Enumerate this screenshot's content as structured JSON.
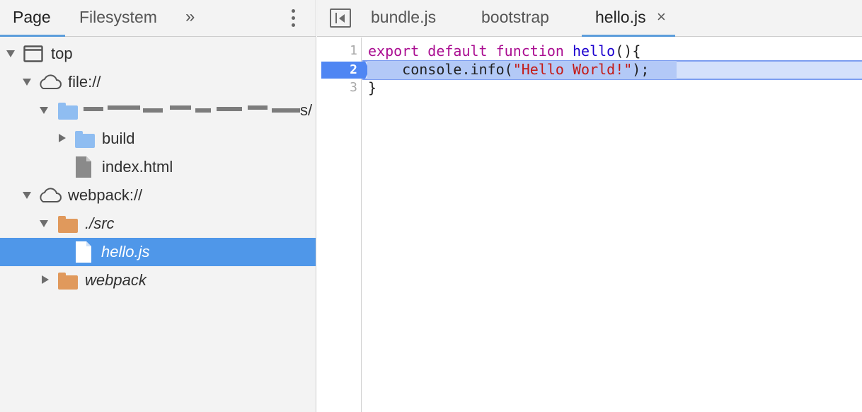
{
  "navigator": {
    "tabs": [
      {
        "label": "Page",
        "active": true
      },
      {
        "label": "Filesystem",
        "active": false
      }
    ],
    "more_label": "»",
    "tree": {
      "top": "top",
      "file_origin": "file://",
      "blurred_folder_suffix": "s/",
      "build": "build",
      "index_html": "index.html",
      "webpack_origin": "webpack://",
      "src": "./src",
      "hello_js": "hello.js",
      "webpack_folder": "webpack"
    }
  },
  "editor": {
    "tabs": [
      {
        "label": "bundle.js",
        "active": false
      },
      {
        "label": "bootstrap",
        "active": false
      },
      {
        "label": "hello.js",
        "active": true
      }
    ],
    "close_glyph": "×",
    "line_numbers": [
      "1",
      "2",
      "3"
    ],
    "paused_line": "2",
    "code": {
      "line1": {
        "kw1": "export",
        "kw2": "default",
        "kw3": "function",
        "name": "hello",
        "rest": "(){"
      },
      "line2": {
        "pre": "console.info(",
        "string": "\"Hello World!\"",
        "post": ");"
      },
      "line3": "}"
    }
  },
  "colors": {
    "accent": "#5c9ddb",
    "selected_row": "#4f97e9",
    "folder_blue": "#8fbdf1",
    "folder_orange": "#e0995c",
    "keyword": "#aa0d91",
    "string": "#c41a16",
    "breakpoint": "#4f86f3"
  },
  "icons": [
    "frame-icon",
    "cloud-icon",
    "folder-icon",
    "file-icon",
    "kebab-menu-icon",
    "toggle-navigator-icon",
    "close-icon"
  ]
}
